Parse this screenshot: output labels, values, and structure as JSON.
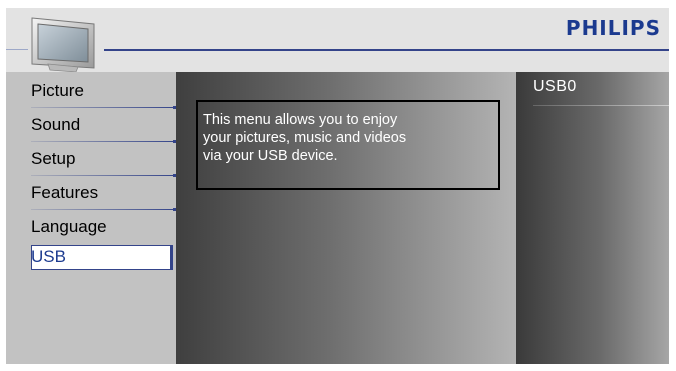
{
  "brand": "PHILIPS",
  "menu": {
    "items": [
      {
        "label": "Picture"
      },
      {
        "label": "Sound"
      },
      {
        "label": "Setup"
      },
      {
        "label": "Features"
      },
      {
        "label": "Language"
      },
      {
        "label": "USB"
      }
    ],
    "selected": "USB"
  },
  "info": {
    "line1": "This menu allows you to enjoy",
    "line2": "your pictures, music and videos",
    "line3": "via your USB device."
  },
  "right_panel": {
    "item": "USB0"
  },
  "icons": {
    "header": "tv-icon"
  },
  "colors": {
    "accent": "#34448a",
    "brand": "#1b3a8f"
  }
}
